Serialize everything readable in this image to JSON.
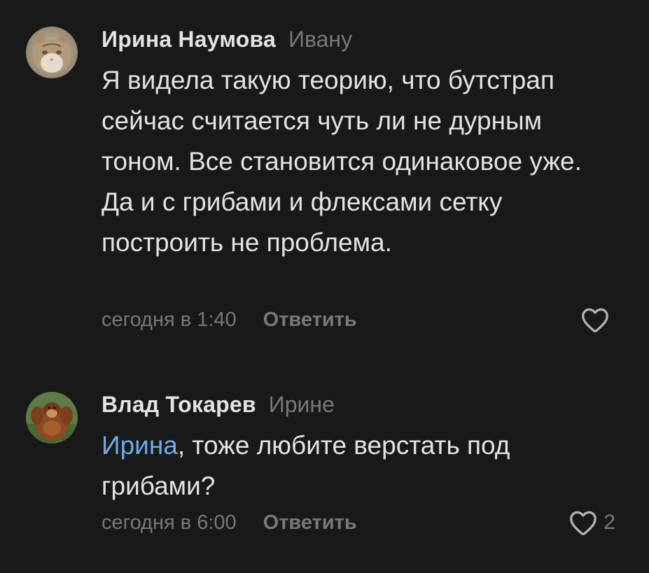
{
  "comments": [
    {
      "author": "Ирина Наумова",
      "reply_to": "Ивану",
      "text": "Я видела такую теорию, что бутстрап сейчас считается чуть ли не дурным тоном. Все становится одинаковое уже. Да и с грибами и флексами сетку построить не проблема.",
      "time": "сегодня в 1:40",
      "reply_label": "Ответить",
      "likes": "",
      "avatar_icon": "cat-avatar-icon",
      "like_icon": "heart-outline-icon"
    },
    {
      "author": "Влад Токарев",
      "reply_to": "Ирине",
      "mention": "Ирина",
      "text": ", тоже любите верстать под грибами?",
      "time": "сегодня в 6:00",
      "reply_label": "Ответить",
      "likes": "2",
      "avatar_icon": "orangutan-avatar-icon",
      "like_icon": "heart-outline-icon"
    }
  ],
  "colors": {
    "background": "#19191a",
    "primary_text": "#e1e3e6",
    "secondary_text": "#76787a",
    "link": "#71aaeb"
  }
}
